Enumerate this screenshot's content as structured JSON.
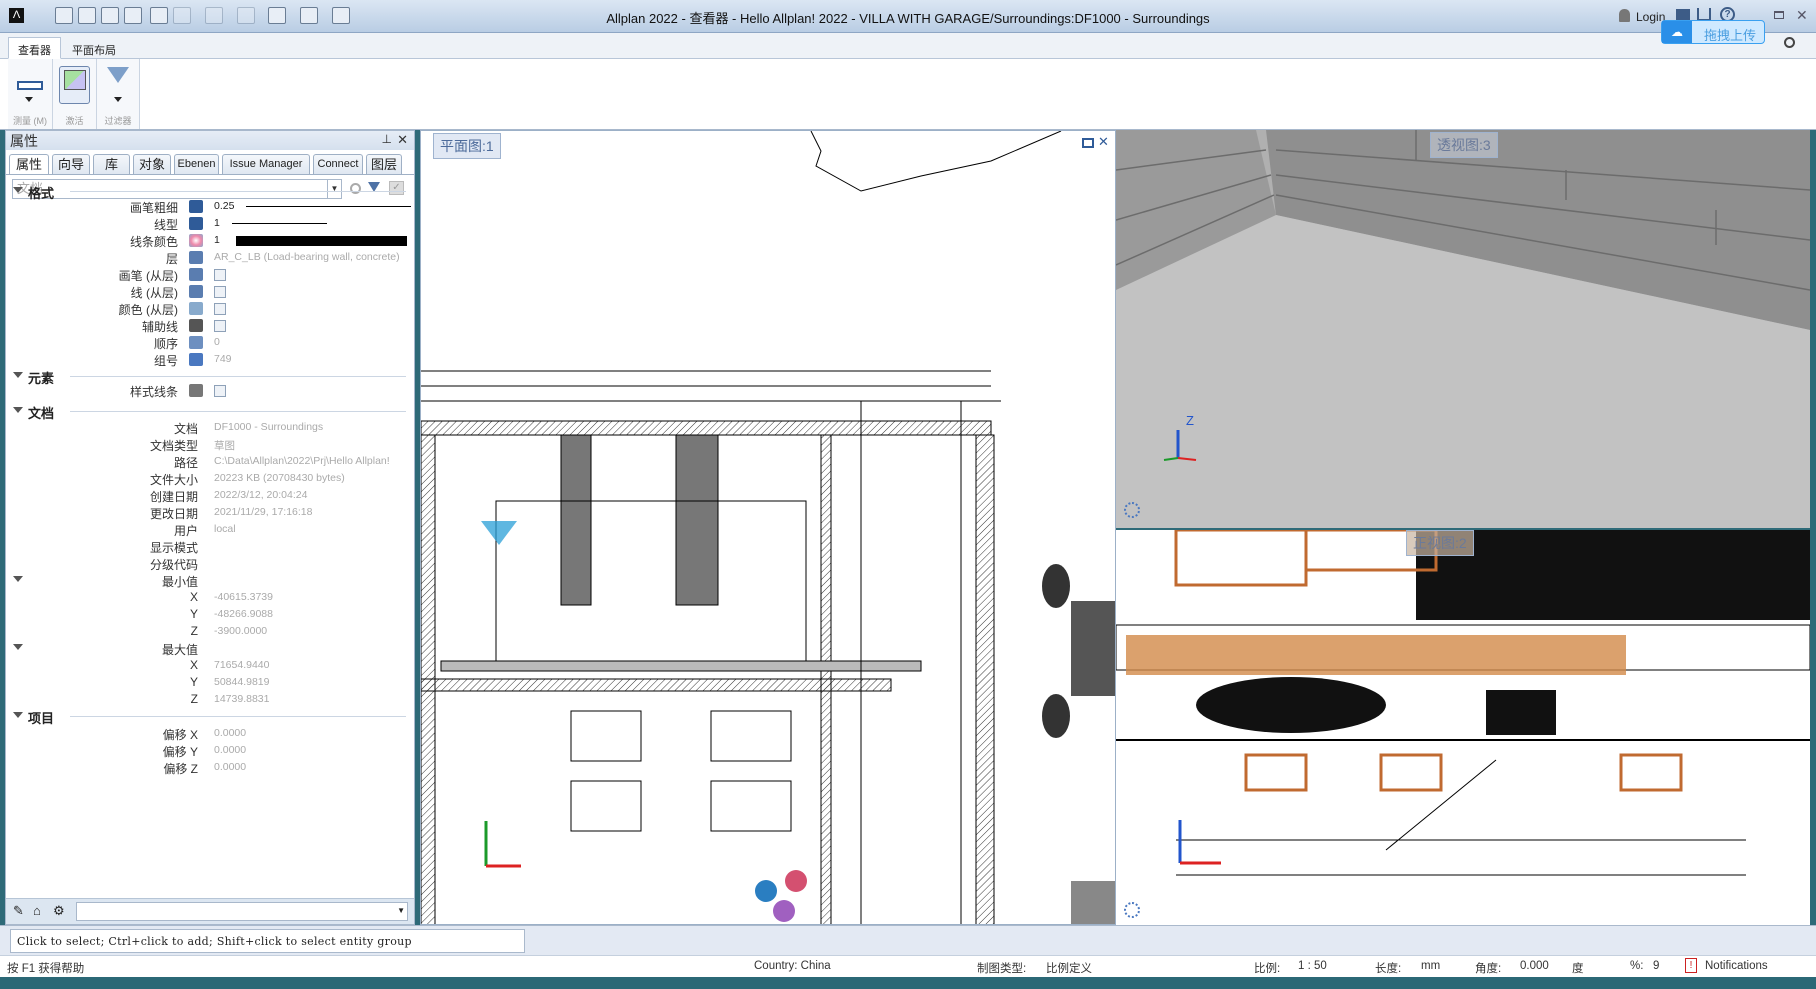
{
  "window": {
    "title": "Allplan 2022 - 查看器 - Hello Allplan! 2022 - VILLA WITH GARAGE/Surroundings:DF1000 - Surroundings",
    "login": "Login",
    "upload_label": "拖拽上传"
  },
  "ribbon": {
    "tabs": [
      {
        "label": "查看器",
        "active": true
      },
      {
        "label": "平面布局",
        "active": false
      }
    ],
    "groups": [
      {
        "label": "测量 (M)",
        "icon": "ruler-icon"
      },
      {
        "label": "激活",
        "icon": "activate-icon"
      },
      {
        "label": "过滤器",
        "icon": "filter-icon"
      }
    ]
  },
  "panel": {
    "title": "属性",
    "tabs": [
      "属性",
      "向导",
      "库",
      "对象",
      "Ebenen",
      "Issue Manager",
      "Connect",
      "图层"
    ],
    "filter_value": "文档",
    "sections": {
      "format": {
        "title": "格式",
        "rows": [
          {
            "label": "画笔粗细",
            "value": "0.25"
          },
          {
            "label": "线型",
            "value": "1"
          },
          {
            "label": "线条颜色",
            "value": "1"
          },
          {
            "label": "层",
            "value": "AR_C_LB (Load-bearing wall, concrete)"
          },
          {
            "label": "画笔 (从层)",
            "value": ""
          },
          {
            "label": "线 (从层)",
            "value": ""
          },
          {
            "label": "颜色 (从层)",
            "value": ""
          },
          {
            "label": "辅助线",
            "value": ""
          },
          {
            "label": "顺序",
            "value": "0"
          },
          {
            "label": "组号",
            "value": "749"
          }
        ]
      },
      "element": {
        "title": "元素",
        "rows": [
          {
            "label": "样式线条",
            "value": ""
          }
        ]
      },
      "document": {
        "title": "文档",
        "rows": [
          {
            "label": "文档",
            "value": "DF1000 - Surroundings"
          },
          {
            "label": "文档类型",
            "value": "草图"
          },
          {
            "label": "路径",
            "value": "C:\\Data\\Allplan\\2022\\Prj\\Hello Allplan!"
          },
          {
            "label": "文件大小",
            "value": "20223 KB (20708430 bytes)"
          },
          {
            "label": "创建日期",
            "value": "2022/3/12, 20:04:24"
          },
          {
            "label": "更改日期",
            "value": "2021/11/29, 17:16:18"
          },
          {
            "label": "用户",
            "value": "local"
          },
          {
            "label": "显示模式",
            "value": ""
          },
          {
            "label": "分级代码",
            "value": ""
          }
        ],
        "min": {
          "label": "最小值",
          "x": "-40615.3739",
          "y": "-48266.9088",
          "z": "-3900.0000"
        },
        "max": {
          "label": "最大值",
          "x": "71654.9440",
          "y": "50844.9819",
          "z": "14739.8831"
        }
      },
      "project": {
        "title": "项目",
        "rows": [
          {
            "label": "偏移 X",
            "value": "0.0000"
          },
          {
            "label": "偏移 Y",
            "value": "0.0000"
          },
          {
            "label": "偏移 Z",
            "value": "0.0000"
          }
        ]
      }
    },
    "axis_labels": {
      "x": "X",
      "y": "Y",
      "z": "Z"
    }
  },
  "views": {
    "plan": "平面图:1",
    "perspective": "透视图:3",
    "front": "正视图:2"
  },
  "command_line": "Click to select; Ctrl+click to add; Shift+click to select entity group",
  "status": {
    "help": "按 F1 获得帮助",
    "country": "Country:  China",
    "drawing_type_label": "制图类型:",
    "drawing_type": "比例定义",
    "scale_label": "比例:",
    "scale": "1 : 50",
    "length_label": "长度:",
    "length": "mm",
    "angle_label": "角度:",
    "angle": "0.000",
    "angle_unit": "度",
    "percent_label": "%:",
    "percent": "9",
    "notifications": "Notifications"
  }
}
